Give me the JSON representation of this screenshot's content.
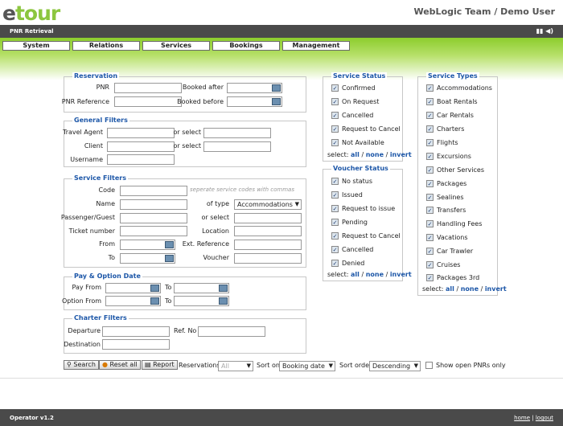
{
  "header": {
    "logo_e": "e",
    "logo_rest": "tour",
    "team": "WebLogic Team / Demo User"
  },
  "titlebar": {
    "title": "PNR Retrieval",
    "icons": "▮▮ ◀)"
  },
  "nav": [
    "System",
    "Relations",
    "Services",
    "Bookings",
    "Management"
  ],
  "reservation": {
    "legend": "Reservation",
    "pnr": "PNR",
    "booked_after": "Booked after",
    "pnr_reference": "PNR Reference",
    "booked_before": "Booked before"
  },
  "general": {
    "legend": "General Filters",
    "travel_agent": "Travel Agent",
    "or_select": "or select",
    "client": "Client",
    "username": "Username"
  },
  "service": {
    "legend": "Service Filters",
    "code": "Code",
    "code_hint": "seperate service codes with commas",
    "name": "Name",
    "of_type": "of type",
    "type_value": "Accommodations",
    "passenger": "Passenger/Guest",
    "or_select": "or select",
    "ticket": "Ticket number",
    "location": "Location",
    "from": "From",
    "ext_ref": "Ext. Reference",
    "to": "To",
    "voucher": "Voucher"
  },
  "pay": {
    "legend": "Pay & Option Date",
    "pay_from": "Pay From",
    "to": "To",
    "option_from": "Option From"
  },
  "charter": {
    "legend": "Charter Filters",
    "departure": "Departure",
    "ref_no": "Ref. No",
    "destination": "Destination"
  },
  "service_status": {
    "legend": "Service Status",
    "items": [
      "Confirmed",
      "On Request",
      "Cancelled",
      "Request to Cancel",
      "Not Available"
    ]
  },
  "voucher_status": {
    "legend": "Voucher Status",
    "items": [
      "No status",
      "Issued",
      "Request to issue",
      "Pending",
      "Request to Cancel",
      "Cancelled",
      "Denied"
    ]
  },
  "service_types": {
    "legend": "Service Types",
    "items": [
      "Accommodations",
      "Boat Rentals",
      "Car Rentals",
      "Charters",
      "Flights",
      "Excursions",
      "Other Services",
      "Packages",
      "Sealines",
      "Transfers",
      "Handling Fees",
      "Vacations",
      "Car Trawler",
      "Cruises",
      "Packages 3rd"
    ]
  },
  "select": {
    "label": "select:",
    "all": "all",
    "sep": "/",
    "none": "none",
    "invert": "invert"
  },
  "bottom": {
    "search": "Search",
    "reset": "Reset all",
    "report": "Report",
    "reservations": "Reservations",
    "reservations_value": "All",
    "sort_on": "Sort on",
    "sort_on_value": "Booking date",
    "sort_order": "Sort order",
    "sort_order_value": "Descending",
    "show_open": "Show open PNRs only"
  },
  "footer": {
    "version": "Operator v1.2",
    "home": "home",
    "sep": "|",
    "logout": "logout"
  },
  "icons": {
    "check": "✓",
    "arrow": "▼",
    "search_icon": "⚲",
    "reset_icon": "●",
    "report_icon": "▤"
  }
}
